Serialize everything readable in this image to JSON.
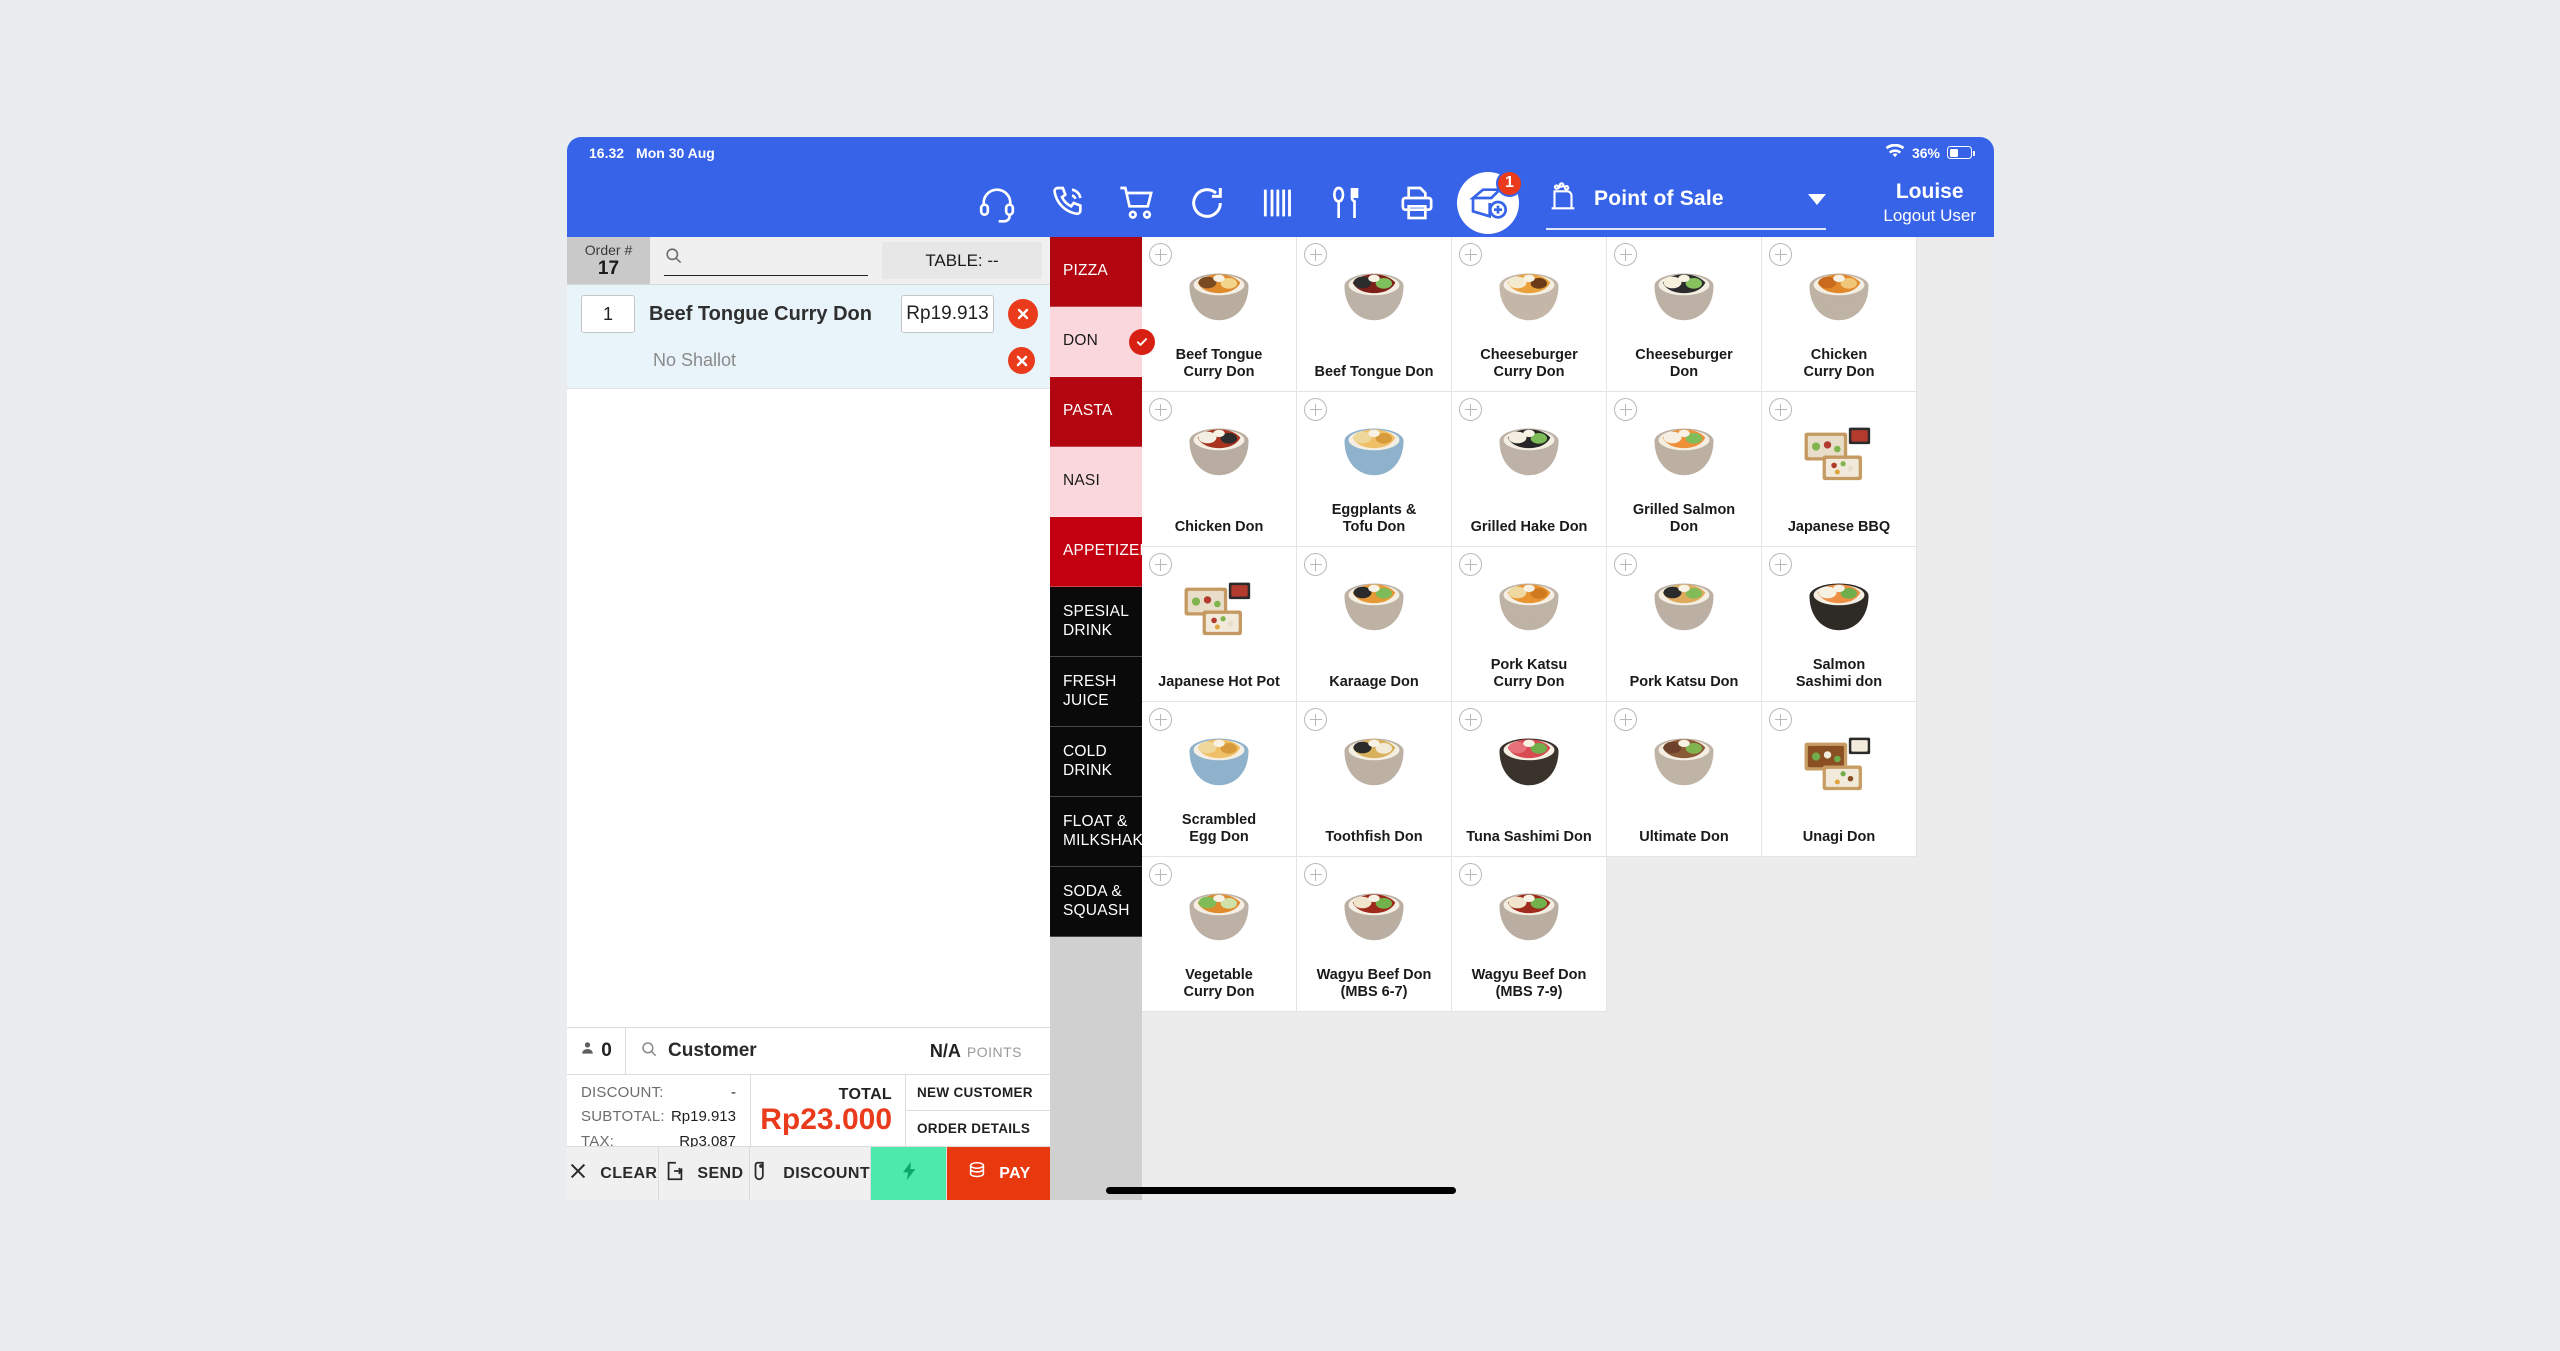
{
  "status_bar": {
    "time": "16.32",
    "date": "Mon 30 Aug",
    "battery": "36%",
    "wifi_icon": "wifi-icon"
  },
  "toolbar": {
    "icons": [
      {
        "name": "headset-icon",
        "label": "Support"
      },
      {
        "name": "phone-call-icon",
        "label": "Call"
      },
      {
        "name": "shopping-cart-icon",
        "label": "Cart"
      },
      {
        "name": "refresh-icon",
        "label": "Refresh"
      },
      {
        "name": "barcode-icon",
        "label": "Barcode"
      },
      {
        "name": "cutlery-icon",
        "label": "Kitchen"
      },
      {
        "name": "printer-icon",
        "label": "Print"
      },
      {
        "name": "add-order-icon",
        "label": "New Order",
        "badge": "1"
      }
    ],
    "mode_icon": "point-of-sale-icon",
    "mode_label": "Point of Sale",
    "user_name": "Louise",
    "logout_label": "Logout User"
  },
  "order": {
    "order_label": "Order #",
    "order_number": "17",
    "search_placeholder": "",
    "search_value": "",
    "table_label": "TABLE: --",
    "items": [
      {
        "qty": "1",
        "name": "Beef Tongue Curry Don",
        "price": "Rp19.913",
        "modifier": "No Shallot"
      }
    ]
  },
  "customer_bar": {
    "guest_count": "0",
    "customer_label": "Customer",
    "points_value": "N/A",
    "points_label": "POINTS"
  },
  "totals": {
    "discount_label": "DISCOUNT:",
    "discount_value": "-",
    "subtotal_label": "SUBTOTAL:",
    "subtotal_value": "Rp19.913",
    "tax_label": "TAX:",
    "tax_value": "Rp3.087",
    "total_label": "TOTAL",
    "total_value": "Rp23.000",
    "new_customer_label": "NEW CUSTOMER",
    "order_details_label": "ORDER DETAILS",
    "total_color": "#ea3b1c"
  },
  "actions": [
    {
      "name": "clear-button",
      "label": "CLEAR",
      "icon": "close-icon"
    },
    {
      "name": "send-button",
      "label": "SEND",
      "icon": "send-document-icon"
    },
    {
      "name": "discount-button",
      "label": "DISCOUNT",
      "icon": "tag-icon"
    },
    {
      "name": "quick-pay-button",
      "label": "",
      "icon": "lightning-icon",
      "color": "#4de8ab"
    },
    {
      "name": "pay-button",
      "label": "PAY",
      "icon": "coins-icon",
      "color": "#e8380d"
    }
  ],
  "categories": [
    {
      "label": "PIZZA",
      "style": "dark-red",
      "selected": false
    },
    {
      "label": "DON",
      "style": "light-red",
      "selected": true
    },
    {
      "label": "PASTA",
      "style": "dark-red",
      "selected": false
    },
    {
      "label": "NASI",
      "style": "light-red",
      "selected": false
    },
    {
      "label": "APPETIZER",
      "style": "crimson",
      "selected": false
    },
    {
      "label": "SPESIAL DRINK",
      "style": "black",
      "selected": false
    },
    {
      "label": "FRESH JUICE",
      "style": "black",
      "selected": false
    },
    {
      "label": "COLD DRINK",
      "style": "black",
      "selected": false
    },
    {
      "label": "FLOAT & MILKSHAKE",
      "style": "black",
      "selected": false
    },
    {
      "label": "SODA & SQUASH",
      "style": "black",
      "selected": false
    }
  ],
  "products": [
    {
      "label": "Beef Tongue\nCurry Don",
      "img": "curry-beef-bowl"
    },
    {
      "label": "Beef Tongue Don",
      "img": "beef-teriyaki-bowl"
    },
    {
      "label": "Cheeseburger\nCurry Don",
      "img": "curry-katsu-bowl"
    },
    {
      "label": "Cheeseburger\nDon",
      "img": "mixed-egg-bowl"
    },
    {
      "label": "Chicken\nCurry Don",
      "img": "curry-chicken-bowl"
    },
    {
      "label": "Chicken Don",
      "img": "chicken-rice-bowl"
    },
    {
      "label": "Eggplants &\nTofu Don",
      "img": "noodle-blue-bowl"
    },
    {
      "label": "Grilled Hake Don",
      "img": "hake-bowl"
    },
    {
      "label": "Grilled Salmon\nDon",
      "img": "salmon-bowl"
    },
    {
      "label": "Japanese BBQ",
      "img": "bento-box"
    },
    {
      "label": "Japanese Hot Pot",
      "img": "bento-box"
    },
    {
      "label": "Karaage Don",
      "img": "karaage-bowl"
    },
    {
      "label": "Pork Katsu\nCurry Don",
      "img": "katsu-curry-bowl"
    },
    {
      "label": "Pork Katsu Don",
      "img": "katsu-bowl"
    },
    {
      "label": "Salmon\nSashimi don",
      "img": "sashimi-dark-bowl"
    },
    {
      "label": "Scrambled\nEgg Don",
      "img": "noodle-blue-bowl"
    },
    {
      "label": "Toothfish Don",
      "img": "toothfish-bowl"
    },
    {
      "label": "Tuna Sashimi Don",
      "img": "tuna-dark-bowl"
    },
    {
      "label": "Ultimate Don",
      "img": "beef-slices-bowl"
    },
    {
      "label": "Unagi Don",
      "img": "unagi-tray"
    },
    {
      "label": "Vegetable\nCurry Don",
      "img": "veg-curry-bowl"
    },
    {
      "label": "Wagyu Beef Don\n(MBS 6-7)",
      "img": "wagyu-bowl"
    },
    {
      "label": "Wagyu Beef Don\n(MBS 7-9)",
      "img": "wagyu-bowl"
    }
  ]
}
